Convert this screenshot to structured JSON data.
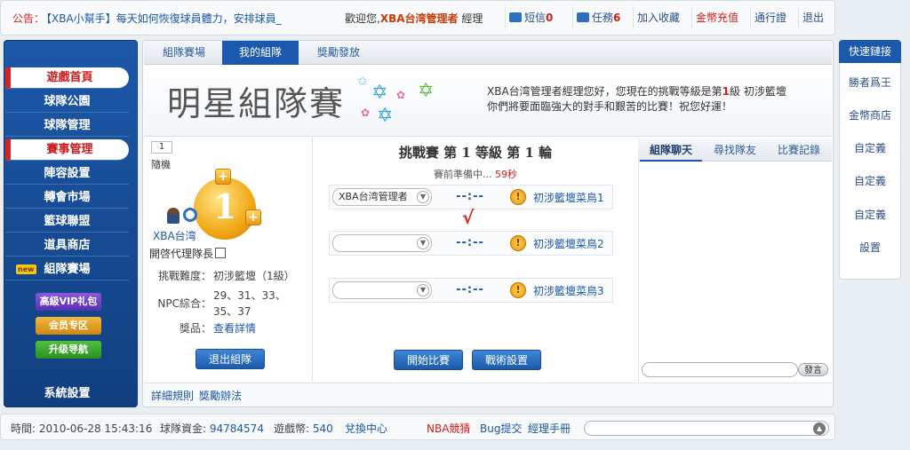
{
  "topbar": {
    "notice_label": "公告：",
    "notice_text": "【XBA小幫手】每天如何恢復球員體力，安排球員_",
    "welcome_prefix": "歡迎您,",
    "manager_name": "XBA台湾管理者",
    "manager_role": "經理",
    "mail_label": "短信",
    "mail_count": "0",
    "task_label": "任務",
    "task_count": "6",
    "favorite_label": "加入收藏",
    "gold_label": "金幣充值",
    "pass_label": "通行證",
    "logout_label": "退出"
  },
  "sidebar": {
    "items": [
      {
        "label": "遊戲首頁",
        "active": true
      },
      {
        "label": "球隊公園",
        "active": false
      },
      {
        "label": "球隊管理",
        "active": false
      },
      {
        "label": "賽事管理",
        "active": true
      },
      {
        "label": "陣容設置",
        "active": false
      },
      {
        "label": "轉會市場",
        "active": false
      },
      {
        "label": "籃球聯盟",
        "active": false
      },
      {
        "label": "道具商店",
        "active": false
      },
      {
        "label": "組隊賽場",
        "active": false,
        "badge": "new"
      }
    ],
    "promos": [
      "高級VIP礼包",
      "会员专区",
      "升级导航"
    ],
    "system_label": "系統設置"
  },
  "main": {
    "tabs": [
      {
        "label": "組隊賽場",
        "active": false
      },
      {
        "label": "我的組隊",
        "active": true
      },
      {
        "label": "獎勵發放",
        "active": false
      }
    ],
    "banner_title": "明星組隊賽",
    "banner_msg_1": "XBA台湾管理者經理您好，您現在的挑戰等級是第",
    "banner_level": "1",
    "banner_msg_2": "級 初涉籃壇",
    "banner_msg_3": "你們將要面臨強大的對手和艱苦的比賽！祝您好運！"
  },
  "left_panel": {
    "round_num": "1",
    "round_label": "隨機",
    "badge_number": "1",
    "team_name": "XBA台湾",
    "proxy_label": "開啓代理隊長",
    "difficulty_label": "挑戰難度：",
    "difficulty_value": "初涉籃壇（1級）",
    "npc_label": "NPC綜合：",
    "npc_value_1": "29、31、33、",
    "npc_value_2": "35、37",
    "reward_label": "獎品：",
    "reward_link": "查看詳情",
    "exit_button": "退出組隊"
  },
  "center_panel": {
    "title": "挑戰賽 第 1 等級 第 1 輪",
    "status_prefix": "賽前準備中...",
    "countdown": "59秒",
    "slots": [
      {
        "player": "XBA台湾管理者",
        "vs": "--:--",
        "npc": "初涉籃壇菜鳥1"
      },
      {
        "player": "",
        "vs": "--:--",
        "npc": "初涉籃壇菜鳥2"
      },
      {
        "player": "",
        "vs": "--:--",
        "npc": "初涉籃壇菜鳥3"
      }
    ],
    "check_mark": "√",
    "start_button": "開始比賽",
    "tactics_button": "戰術設置"
  },
  "right_panel": {
    "tabs": [
      {
        "label": "組隊聊天",
        "active": true
      },
      {
        "label": "尋找隊友",
        "active": false
      },
      {
        "label": "比賽記錄",
        "active": false
      }
    ],
    "send_button": "發言"
  },
  "bottom_links": {
    "rules": "詳細規則",
    "rewards": "獎勵辦法"
  },
  "quick_links": {
    "title": "快速鏈接",
    "items": [
      "勝者爲王",
      "金幣商店",
      "自定義",
      "自定義",
      "自定義",
      "設置"
    ]
  },
  "footer": {
    "time_label": "時間:",
    "time_value": "2010-06-28 15:43:16",
    "funds_label": "球隊資金:",
    "funds_value": "94784574",
    "coins_label": "遊戲幣:",
    "coins_value": "540",
    "exchange_label": "兌換中心",
    "nba_label": "NBA競猜",
    "bug_label": "Bug提交",
    "manual_label": "經理手冊"
  },
  "colors": {
    "primary_blue": "#1a59ae",
    "accent_red": "#d0201a",
    "gold": "#f2a814"
  }
}
